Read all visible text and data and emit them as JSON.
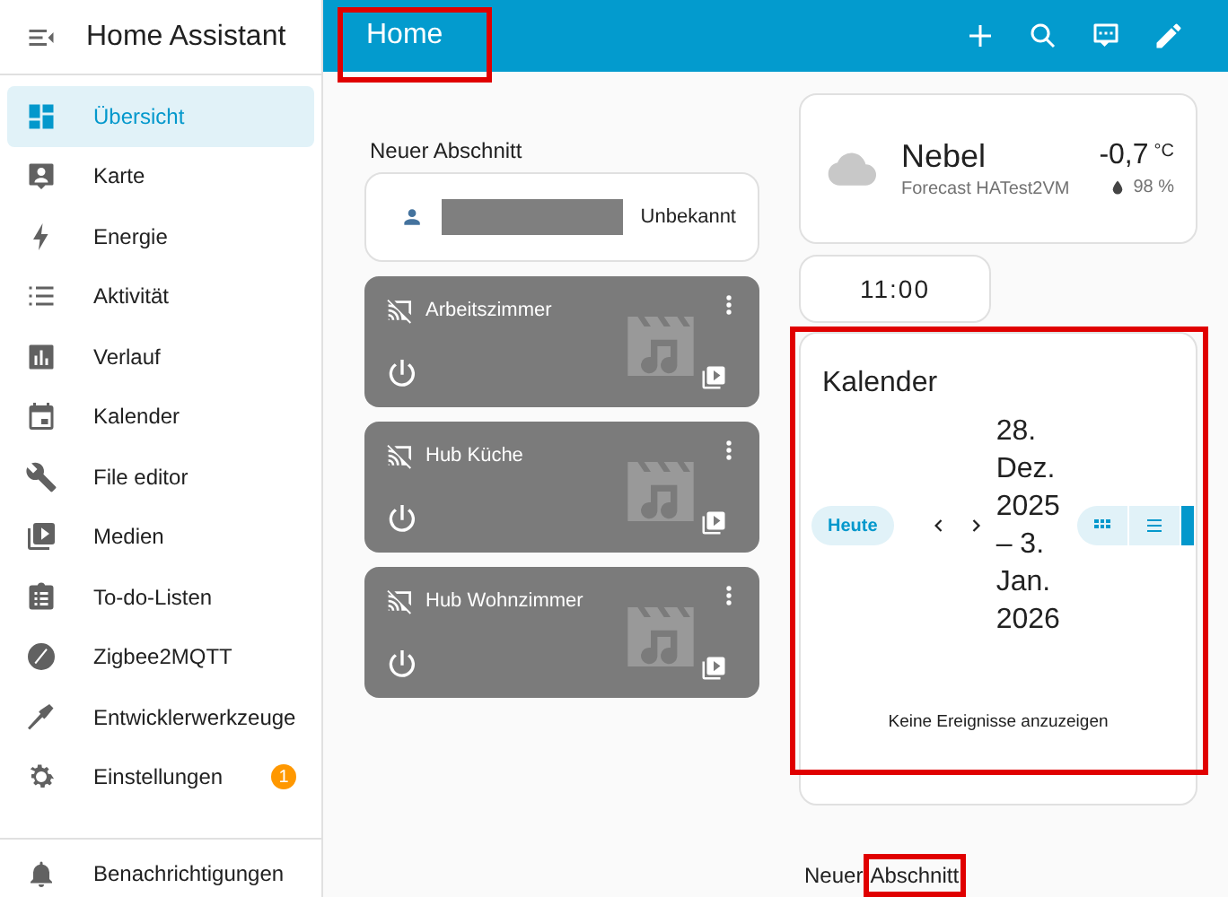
{
  "sidebar": {
    "title": "Home Assistant",
    "items": [
      {
        "label": "Übersicht",
        "selected": true
      },
      {
        "label": "Karte",
        "selected": false
      },
      {
        "label": "Energie",
        "selected": false
      },
      {
        "label": "Aktivität",
        "selected": false
      },
      {
        "label": "Verlauf",
        "selected": false
      },
      {
        "label": "Kalender",
        "selected": false
      },
      {
        "label": "File editor",
        "selected": false
      },
      {
        "label": "Medien",
        "selected": false
      },
      {
        "label": "To-do-Listen",
        "selected": false
      },
      {
        "label": "Zigbee2MQTT",
        "selected": false
      },
      {
        "label": "Entwicklerwerkzeuge",
        "selected": false
      },
      {
        "label": "Einstellungen",
        "selected": false,
        "badge": "1"
      }
    ],
    "footer_items": [
      {
        "label": "Benachrichtigungen"
      }
    ]
  },
  "header": {
    "title": "Home"
  },
  "left_section": {
    "title": "Neuer Abschnitt",
    "person_card": {
      "state": "Unbekannt"
    },
    "media_cards": [
      {
        "name": "Arbeitszimmer"
      },
      {
        "name": "Hub Küche"
      },
      {
        "name": "Hub Wohnzimmer"
      }
    ]
  },
  "weather_card": {
    "condition": "Nebel",
    "source": "Forecast HATest2VM",
    "temperature": "-0,7",
    "unit": "°C",
    "humidity": "98 %"
  },
  "clock_card": {
    "time": "11:00"
  },
  "calendar_card": {
    "title": "Kalender",
    "today_button": "Heute",
    "range": "28. Dez. 2025 – 3. Jan. 2026",
    "empty_message": "Keine Ereignisse anzuzeigen",
    "views": [
      {
        "selected": false
      },
      {
        "selected": false
      },
      {
        "selected": true
      }
    ]
  },
  "second_section": {
    "title_parts": [
      "Neuer",
      "Abschnitt"
    ]
  }
}
